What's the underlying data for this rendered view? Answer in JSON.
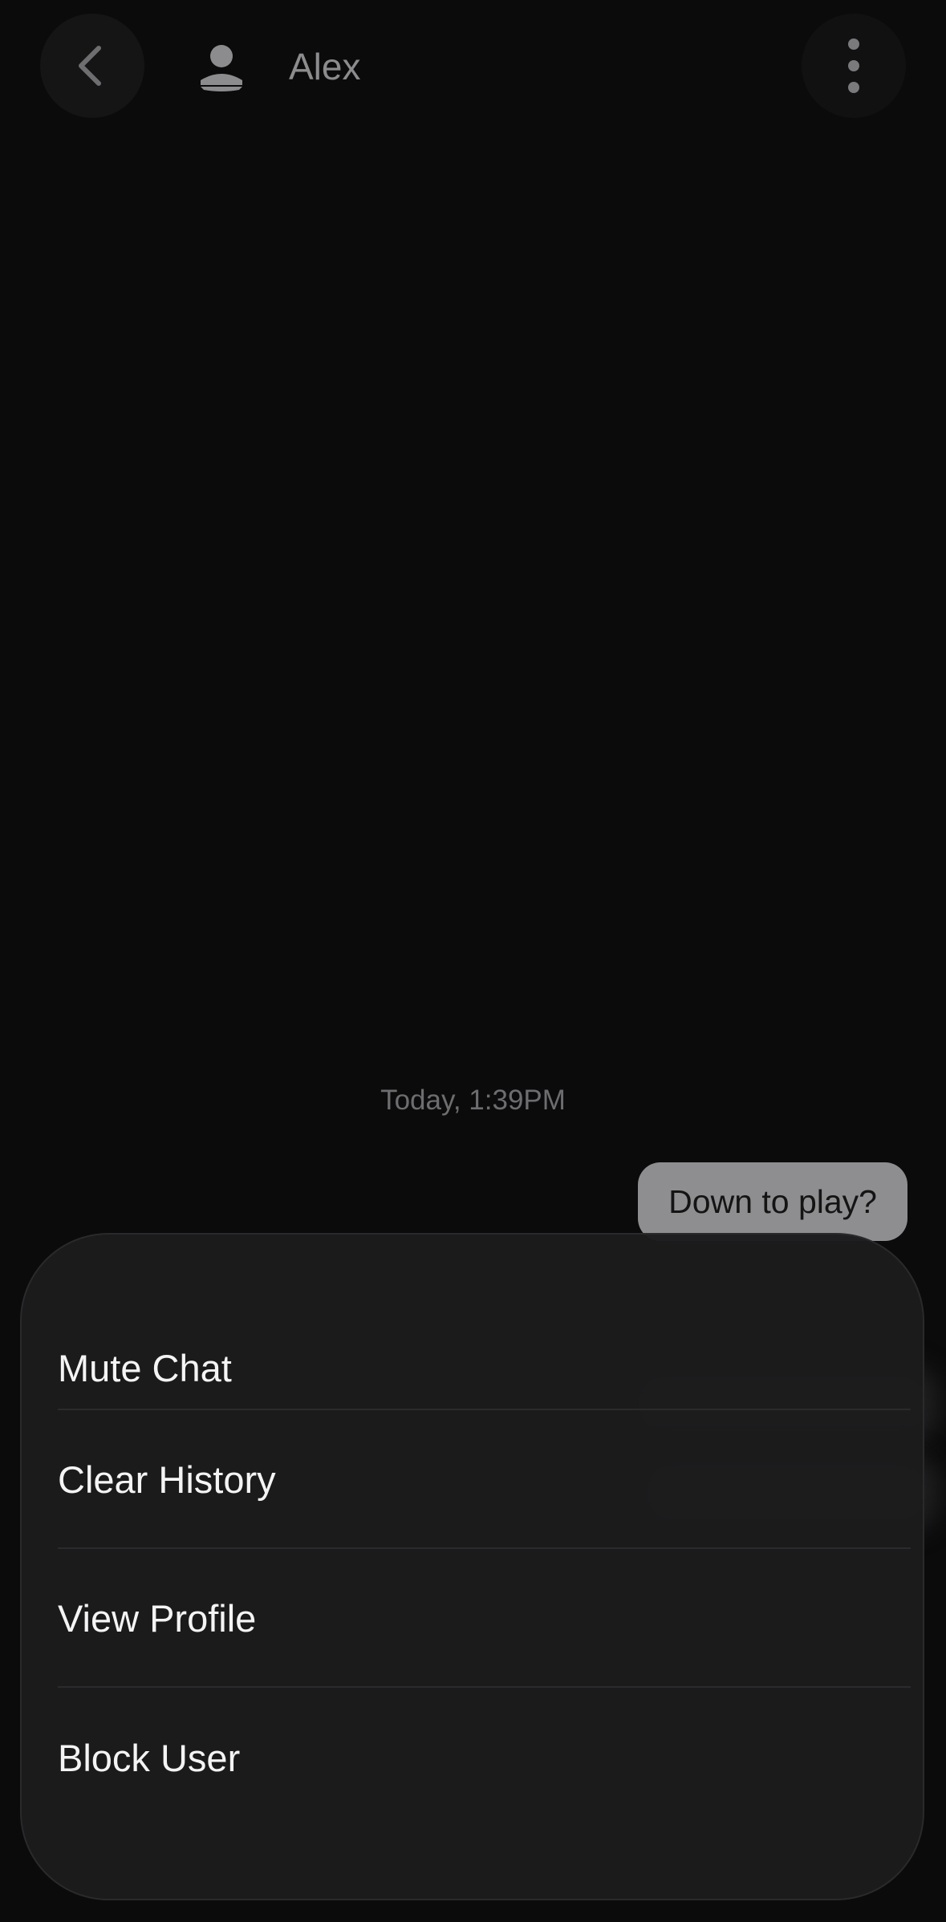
{
  "header": {
    "contact_name": "Alex",
    "back_icon": "chevron-left-icon",
    "avatar_icon": "person-icon",
    "status_icon": "moon-icon",
    "status_color": "#c58a1b",
    "menu_icon": "vertical-ellipsis-icon"
  },
  "conversation": {
    "timestamp": "Today, 1:39PM",
    "messages": [
      {
        "text": "Down to play?",
        "sender": "me"
      }
    ]
  },
  "action_sheet": {
    "items": [
      {
        "label": "Mute Chat"
      },
      {
        "label": "Clear History"
      },
      {
        "label": "View Profile"
      },
      {
        "label": "Block User"
      }
    ]
  },
  "colors": {
    "background": "#0b0b0c",
    "sheet_background": "#1c1c1d",
    "bubble_background": "#8e8e90"
  }
}
